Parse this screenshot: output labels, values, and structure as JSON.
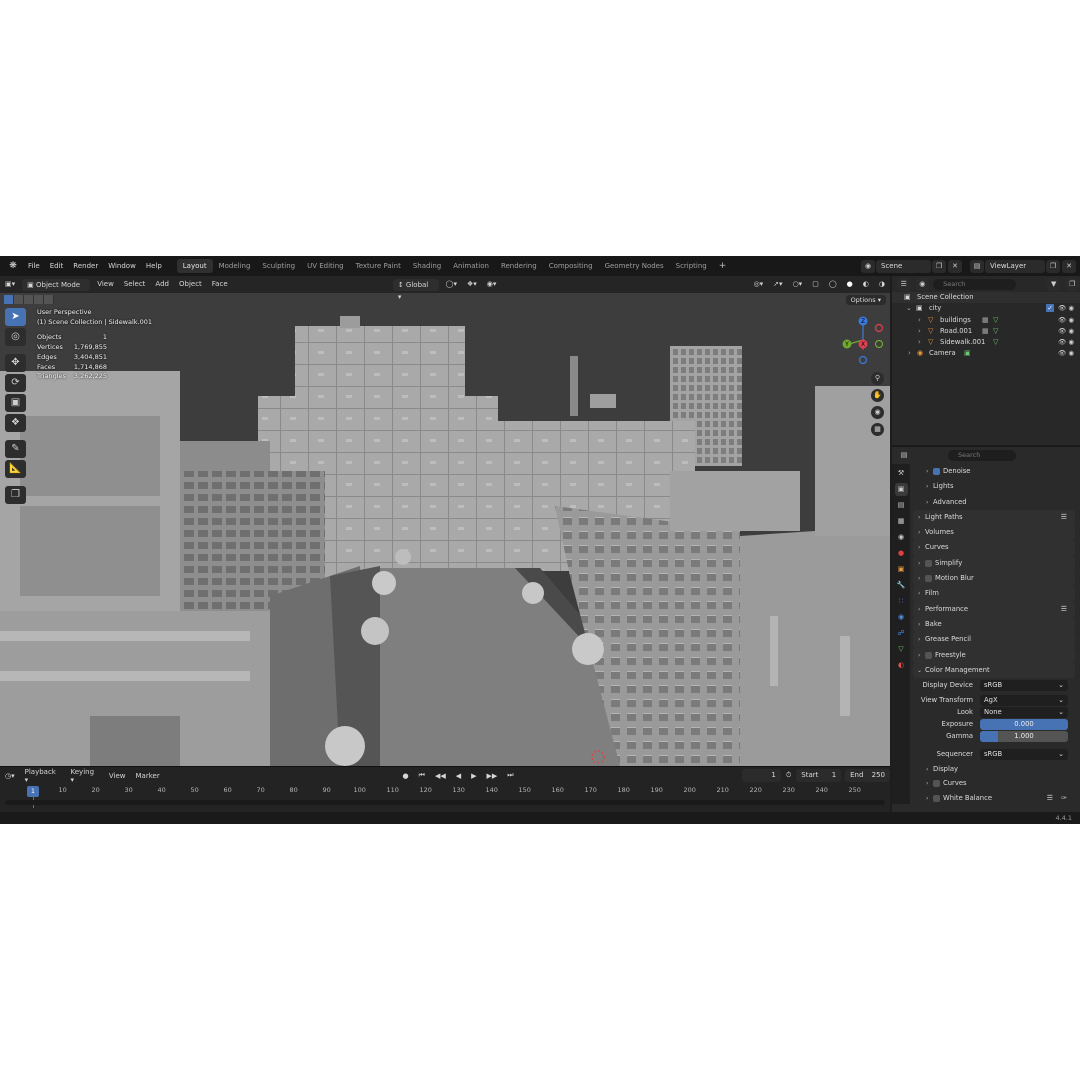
{
  "menu": [
    "File",
    "Edit",
    "Render",
    "Window",
    "Help"
  ],
  "workspaces": [
    {
      "label": "Layout",
      "active": true
    },
    {
      "label": "Modeling",
      "active": false
    },
    {
      "label": "Sculpting",
      "active": false
    },
    {
      "label": "UV Editing",
      "active": false
    },
    {
      "label": "Texture Paint",
      "active": false
    },
    {
      "label": "Shading",
      "active": false
    },
    {
      "label": "Animation",
      "active": false
    },
    {
      "label": "Rendering",
      "active": false
    },
    {
      "label": "Compositing",
      "active": false
    },
    {
      "label": "Geometry Nodes",
      "active": false
    },
    {
      "label": "Scripting",
      "active": false
    }
  ],
  "topright": {
    "scene": "Scene",
    "view_layer": "ViewLayer"
  },
  "viewport": {
    "mode": "Object Mode",
    "menus": [
      "View",
      "Select",
      "Add",
      "Object",
      "Face"
    ],
    "transform_orientation": "Global",
    "options": "Options",
    "overlay_title": "User Perspective",
    "overlay_subtitle": "(1) Scene Collection | Sidewalk.001",
    "stats": [
      {
        "label": "Objects",
        "value": "1"
      },
      {
        "label": "Vertices",
        "value": "1,769,855"
      },
      {
        "label": "Edges",
        "value": "3,404,851"
      },
      {
        "label": "Faces",
        "value": "1,714,868"
      },
      {
        "label": "Triangles",
        "value": "3,262,225"
      }
    ],
    "gizmo": {
      "x": "X",
      "y": "Y",
      "z": "Z"
    }
  },
  "timeline": {
    "menus": [
      "Playback",
      "Keying",
      "View",
      "Marker"
    ],
    "current_frame": "1",
    "start_label": "Start",
    "start": "1",
    "end_label": "End",
    "end": "250",
    "ticks": [
      "10",
      "20",
      "30",
      "40",
      "50",
      "60",
      "70",
      "80",
      "90",
      "100",
      "110",
      "120",
      "130",
      "140",
      "150",
      "160",
      "170",
      "180",
      "190",
      "200",
      "210",
      "220",
      "230",
      "240",
      "250"
    ],
    "cursor": "1"
  },
  "outliner": {
    "search_placeholder": "Search",
    "rows": [
      {
        "label": "Scene Collection"
      },
      {
        "label": "city"
      },
      {
        "label": "buildings"
      },
      {
        "label": "Road.001"
      },
      {
        "label": "Sidewalk.001"
      },
      {
        "label": "Camera"
      }
    ]
  },
  "properties": {
    "search_placeholder": "Search",
    "rows": {
      "denoise": "Denoise",
      "lights": "Lights",
      "advanced": "Advanced",
      "light_paths": "Light Paths",
      "volumes": "Volumes",
      "curves": "Curves",
      "simplify": "Simplify",
      "motion_blur": "Motion Blur",
      "film": "Film",
      "performance": "Performance",
      "bake": "Bake",
      "grease_pencil": "Grease Pencil",
      "freestyle": "Freestyle",
      "color_management": "Color Management",
      "display_device_label": "Display Device",
      "display_device": "sRGB",
      "view_transform_label": "View Transform",
      "view_transform": "AgX",
      "look_label": "Look",
      "look": "None",
      "exposure_label": "Exposure",
      "exposure": "0.000",
      "gamma_label": "Gamma",
      "gamma": "1.000",
      "gamma_fill": 0.2,
      "sequencer_label": "Sequencer",
      "sequencer": "sRGB",
      "display": "Display",
      "curves2": "Curves",
      "white_balance": "White Balance"
    }
  },
  "status": {
    "version": "4.4.1"
  },
  "colors": {
    "accent": "#4772b3",
    "axis_x": "#e0404f",
    "axis_y": "#70a830",
    "axis_z": "#3c7ae0"
  }
}
